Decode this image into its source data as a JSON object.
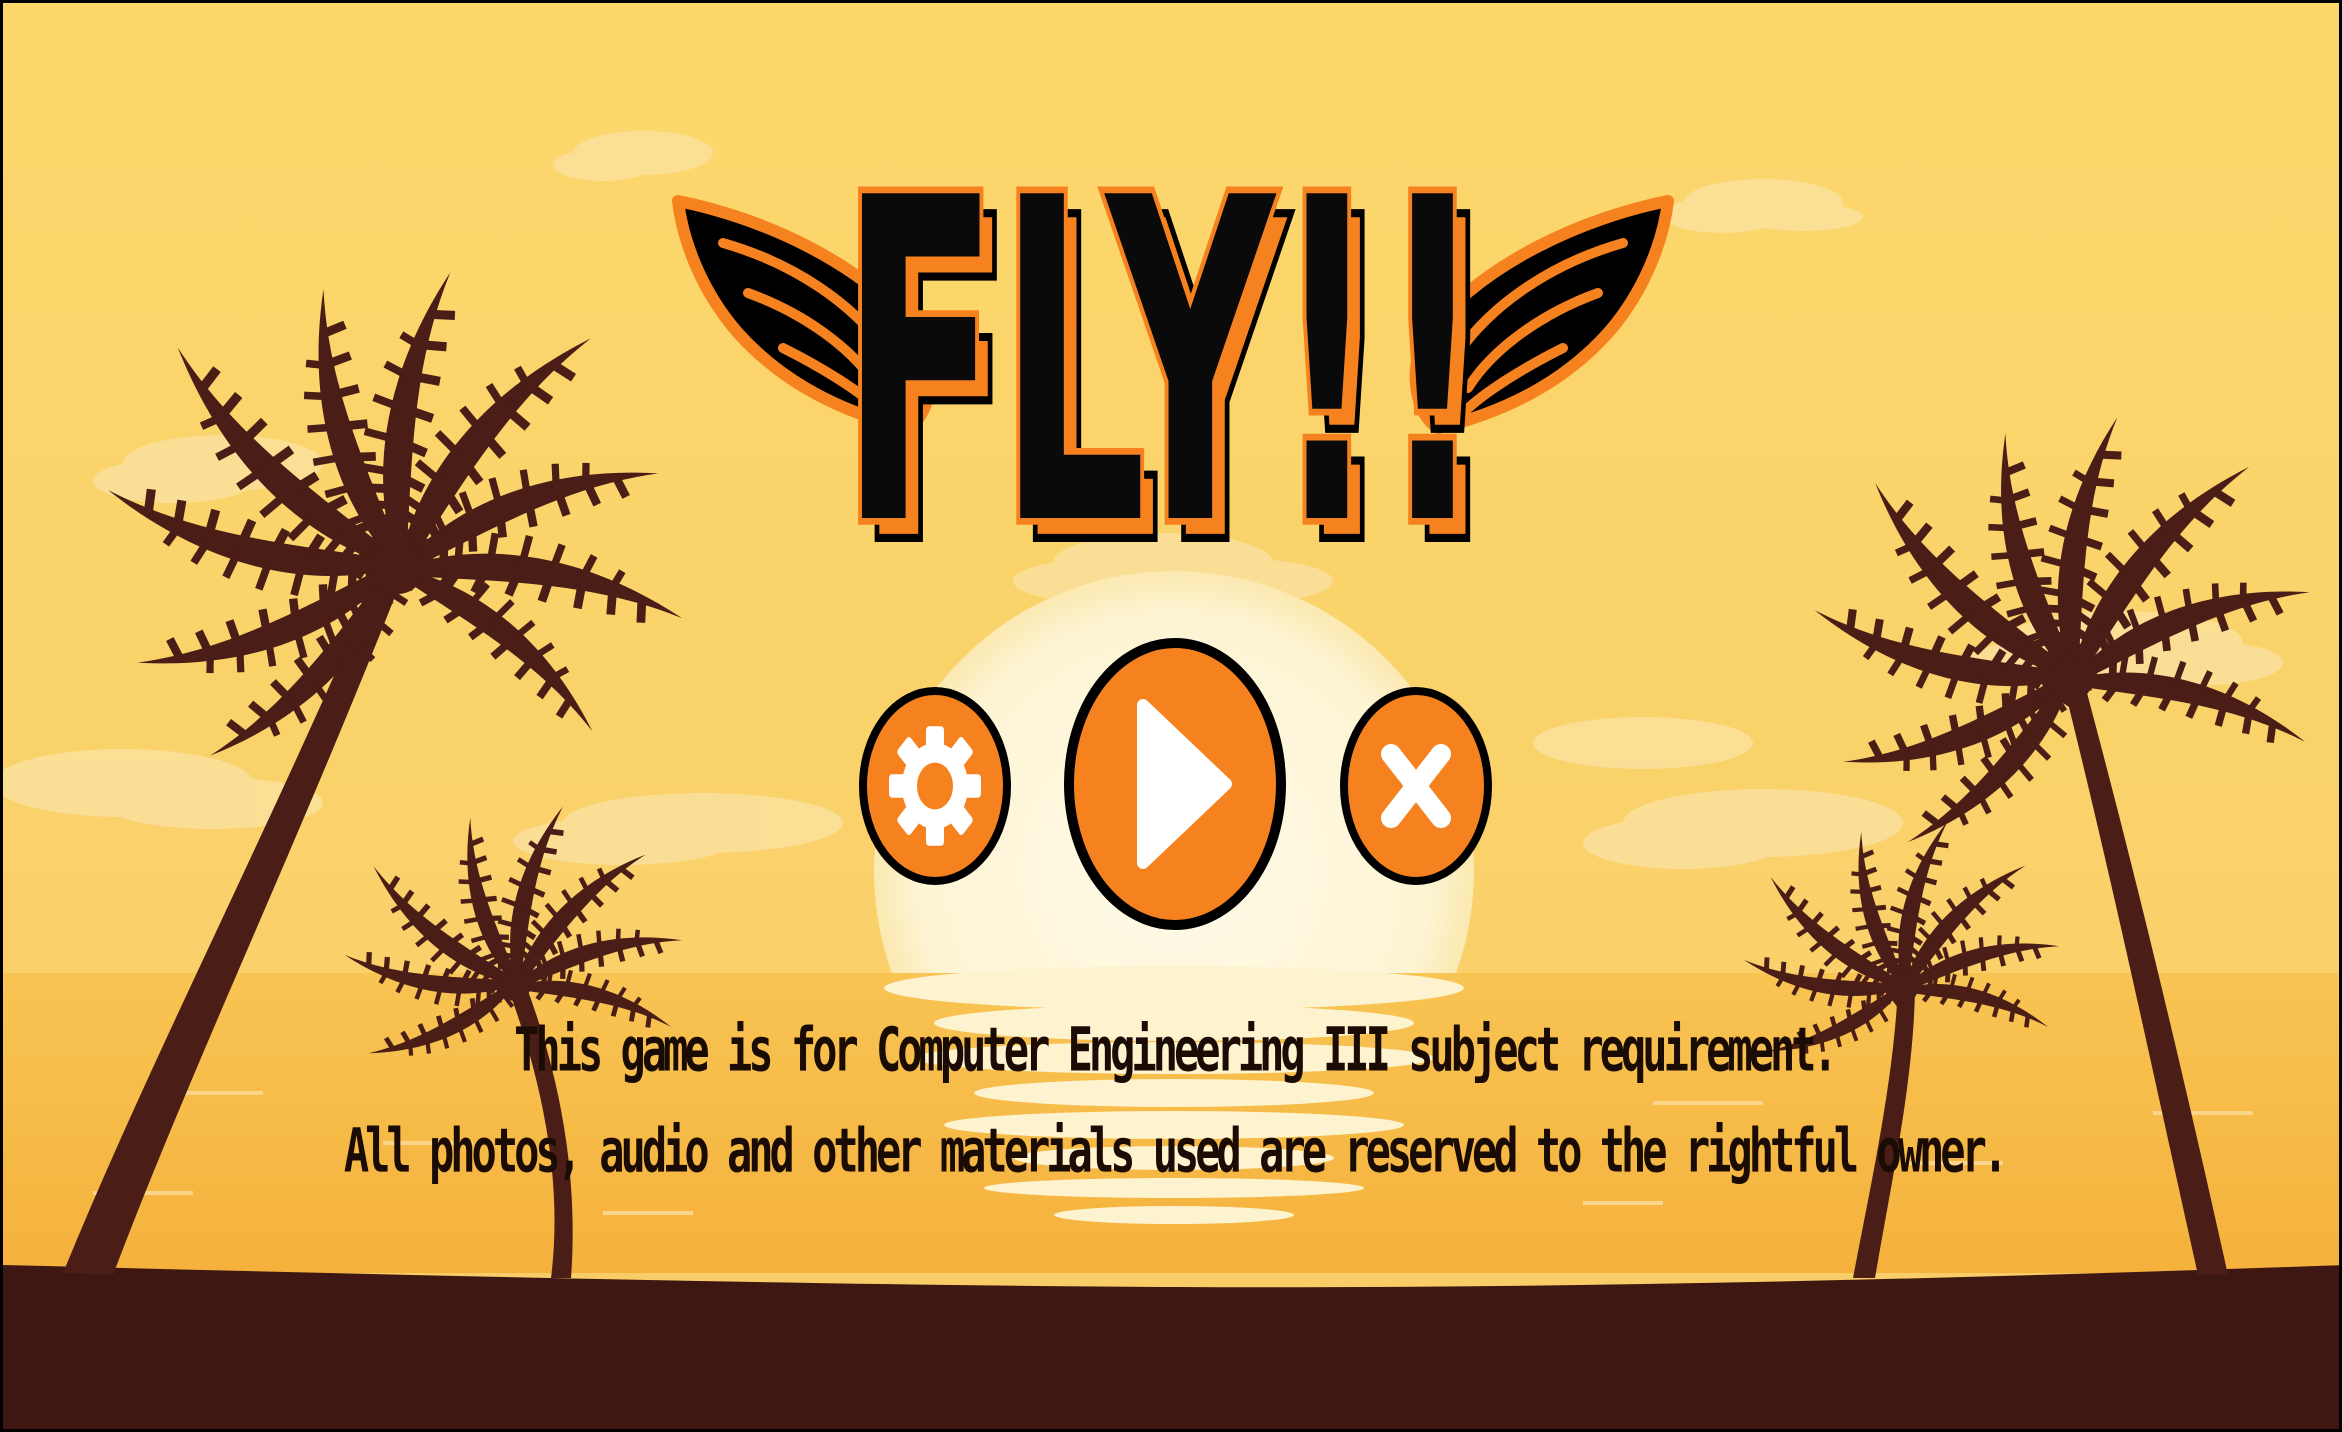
{
  "game": {
    "title": "FLY!!"
  },
  "menu": {
    "settings_icon": "gear-icon",
    "play_icon": "play-icon",
    "close_icon": "close-x-icon"
  },
  "credits": {
    "line1": "This game is for Computer Engineering III subject requirement.",
    "line2": "All photos, audio and other materials used are reserved to the rightful owner."
  },
  "colors": {
    "sky_top": "#fbd56a",
    "sky_bottom": "#f7cc6a",
    "sun": "#fdf6dc",
    "sea": "#f7bb4a",
    "ground": "#3e1713",
    "palm": "#4a1e16",
    "accent_orange": "#f5821f",
    "outline": "#000000",
    "icon_white": "#ffffff"
  }
}
